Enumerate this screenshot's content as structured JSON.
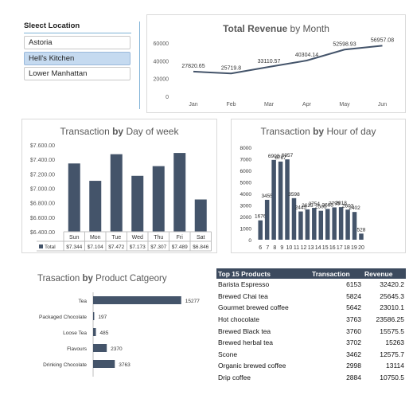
{
  "slicer": {
    "header": "Sleect Location",
    "items": [
      {
        "label": "Astoria",
        "selected": false
      },
      {
        "label": "Hell's Kitchen",
        "selected": true
      },
      {
        "label": "Lower Manhattan",
        "selected": false
      }
    ]
  },
  "colors": {
    "bar": "#44546a",
    "line": "#44546a",
    "slicer_selected": "#c5daf0",
    "table_header": "#3c4a5e"
  },
  "charts": {
    "revenue_by_month": {
      "title_bold": "Total Revenue",
      "title_rest": " by Month"
    },
    "by_day": {
      "title_rest": "Transaction ",
      "title_bold": "by",
      "title_end": " Day of week"
    },
    "by_hour": {
      "title_rest": "Transaction ",
      "title_bold": "by",
      "title_end": " Hour of day"
    },
    "by_category": {
      "title_rest": "Trasaction ",
      "title_bold": "by",
      "title_end": " Product Catgeory"
    }
  },
  "chart_data": [
    {
      "id": "revenue_by_month",
      "type": "line",
      "title": "Total Revenue by Month",
      "categories": [
        "Jan",
        "Feb",
        "Mar",
        "Apr",
        "May",
        "Jun"
      ],
      "values": [
        27820.65,
        25719.8,
        33110.57,
        40304.14,
        52598.93,
        56957.08
      ],
      "data_labels": [
        "27820.65",
        "25719.8",
        "33110.57",
        "40304.14",
        "52598.93",
        "56957.08"
      ],
      "yticks": [
        "0",
        "20000",
        "40000",
        "60000"
      ],
      "ylim": [
        0,
        60000
      ],
      "grid": false
    },
    {
      "id": "by_day",
      "type": "bar",
      "title": "Transaction by Day of week",
      "categories": [
        "Sun",
        "Mon",
        "Tue",
        "Wed",
        "Thu",
        "Fri",
        "Sat"
      ],
      "values": [
        7344,
        7104,
        7472,
        7173,
        7307,
        7489,
        6846
      ],
      "table_values": [
        "$7.344",
        "$7.104",
        "$7.472",
        "$7.173",
        "$7.307",
        "$7.489",
        "$6.846"
      ],
      "table_row_label": "Total",
      "yticks": [
        "$6.400.00",
        "$6.600.00",
        "$6.800.00",
        "$7.000.00",
        "$7.200.00",
        "$7.400.00",
        "$7.600.00"
      ],
      "ylim": [
        6400,
        7600
      ],
      "grid": false
    },
    {
      "id": "by_hour",
      "type": "bar",
      "title": "Transaction by Hour of day",
      "categories": [
        "6",
        "7",
        "8",
        "9",
        "10",
        "11",
        "12",
        "13",
        "14",
        "15",
        "16",
        "17",
        "18",
        "19",
        "20"
      ],
      "values": [
        1676,
        3455,
        6908,
        6767,
        6957,
        3598,
        2445,
        2625,
        2754,
        2505,
        2665,
        2795,
        2818,
        2603,
        2402,
        528
      ],
      "data_labels": [
        "1676",
        "3455",
        "6908",
        "6767",
        "6957",
        "3598",
        "2445",
        "2625",
        "2754",
        "2505",
        "2665",
        "2795",
        "2818",
        "2603",
        "2402",
        "528"
      ],
      "yticks": [
        "0",
        "1000",
        "2000",
        "3000",
        "4000",
        "5000",
        "6000",
        "7000",
        "8000"
      ],
      "ylim": [
        0,
        8000
      ],
      "grid": false
    },
    {
      "id": "by_category",
      "type": "bar",
      "orientation": "horizontal",
      "title": "Trasaction by Product Catgeory",
      "categories": [
        "Tea",
        "Packaged Chocolate",
        "Loose Tea",
        "Flavours",
        "Drinking Chocolate"
      ],
      "values": [
        15277,
        197,
        485,
        2370,
        3763
      ],
      "data_labels": [
        "15277",
        "197",
        "485",
        "2370",
        "3763"
      ],
      "xlim": [
        0,
        16000
      ],
      "grid": false
    },
    {
      "id": "top_products",
      "type": "table",
      "columns": [
        "Top 15 Products",
        "Transaction",
        "Revenue"
      ],
      "rows": [
        [
          "Barista Espresso",
          "6153",
          "32420.2"
        ],
        [
          "Brewed Chai tea",
          "5824",
          "25645.3"
        ],
        [
          "Gourmet brewed coffee",
          "5642",
          "23010.1"
        ],
        [
          "Hot chocolate",
          "3763",
          "23586.25"
        ],
        [
          "Brewed Black tea",
          "3760",
          "15575.5"
        ],
        [
          "Brewed herbal tea",
          "3702",
          "15263"
        ],
        [
          "Scone",
          "3462",
          "12575.7"
        ],
        [
          "Organic brewed coffee",
          "2998",
          "13114"
        ],
        [
          "Drip coffee",
          "2884",
          "10750.5"
        ]
      ]
    }
  ]
}
